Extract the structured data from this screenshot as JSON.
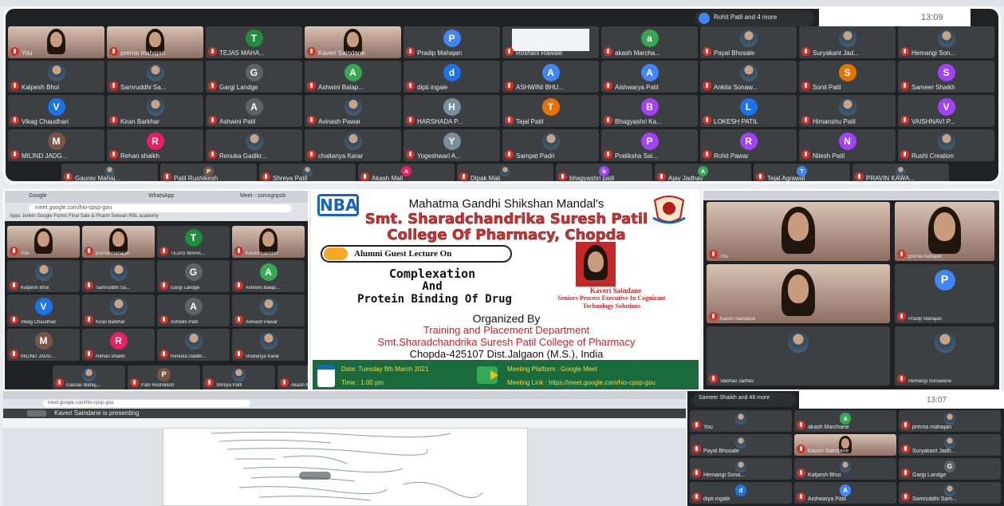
{
  "top_grid": {
    "presenter_chip": "Rohit Patil and 4 more",
    "clock": "13:09",
    "participants": [
      {
        "name": "You",
        "type": "cam"
      },
      {
        "name": "prerna mahajan",
        "type": "cam"
      },
      {
        "name": "TEJAS MAHA...",
        "initial": "T",
        "color": "#1e8e3e"
      },
      {
        "name": "Kaveri Saindane",
        "type": "cam"
      },
      {
        "name": "Pradip Mahajan",
        "initial": "P",
        "color": "#4285f4"
      },
      {
        "name": "Roshani Rawale",
        "type": "screen"
      },
      {
        "name": "akash Marcha...",
        "initial": "a",
        "color": "#34a853"
      },
      {
        "name": "Payal Bhosale",
        "type": "photo"
      },
      {
        "name": "Suryakant Jad...",
        "type": "photo"
      },
      {
        "name": "Hemangi Son...",
        "type": "photo"
      },
      {
        "name": "Kalpesh Bhoi",
        "type": "photo"
      },
      {
        "name": "Samruddhi Sa...",
        "type": "photo"
      },
      {
        "name": "Gargi Landge",
        "initial": "G",
        "color": "#5f6368"
      },
      {
        "name": "Ashwini Balap...",
        "initial": "A",
        "color": "#34a853"
      },
      {
        "name": "dipti ingale",
        "initial": "d",
        "color": "#1a73e8"
      },
      {
        "name": "ASHWINI BHU...",
        "initial": "A",
        "color": "#4285f4"
      },
      {
        "name": "Aishwarya Patil",
        "initial": "A",
        "color": "#4285f4"
      },
      {
        "name": "Ankita Sonaw...",
        "type": "photo"
      },
      {
        "name": "Sonil Patil",
        "initial": "S",
        "color": "#e37400"
      },
      {
        "name": "Sameer Shaikh",
        "initial": "S",
        "color": "#a142f4"
      },
      {
        "name": "Vikag Chaudhari",
        "initial": "V",
        "color": "#1a73e8"
      },
      {
        "name": "Kiran Barkhar",
        "type": "photo"
      },
      {
        "name": "Ashwini Patil",
        "initial": "A",
        "color": "#5f6368"
      },
      {
        "name": "Avinash Pawar",
        "type": "photo"
      },
      {
        "name": "HARSHADA P...",
        "initial": "H",
        "color": "#78909c"
      },
      {
        "name": "Tejal Patil",
        "initial": "T",
        "color": "#e8710a"
      },
      {
        "name": "Bhagyashri Ka...",
        "initial": "B",
        "color": "#a142f4"
      },
      {
        "name": "LOKESH PATIL",
        "initial": "L",
        "color": "#1a73e8"
      },
      {
        "name": "Himanshu Patil",
        "type": "photo"
      },
      {
        "name": "VAISHNAVI P...",
        "initial": "V",
        "color": "#a142f4"
      },
      {
        "name": "MILIND JADG...",
        "initial": "M",
        "color": "#795548"
      },
      {
        "name": "Rehan shaikh",
        "initial": "R",
        "color": "#e91e63"
      },
      {
        "name": "Renuka Gadikr...",
        "type": "photo"
      },
      {
        "name": "chaitanya Karar",
        "type": "photo"
      },
      {
        "name": "Yogeshwari A...",
        "initial": "Y",
        "color": "#78909c"
      },
      {
        "name": "Sampat Padri",
        "type": "photo"
      },
      {
        "name": "Pratiksha Sai...",
        "initial": "P",
        "color": "#a142f4"
      },
      {
        "name": "Rohit Pawar",
        "initial": "R",
        "color": "#a142f4"
      },
      {
        "name": "Nilesh Patil",
        "initial": "N",
        "color": "#a142f4"
      },
      {
        "name": "Rushi Creation",
        "type": "photo"
      }
    ],
    "bottom_row": [
      {
        "name": "Gaurav Mahaj...",
        "type": "photo"
      },
      {
        "name": "Patil Rushikesh",
        "initial": "P",
        "color": "#795548"
      },
      {
        "name": "Shreya Patil",
        "type": "photo"
      },
      {
        "name": "Akash Mali",
        "initial": "A",
        "color": "#e91e63"
      },
      {
        "name": "Dipak Mali",
        "type": "photo"
      },
      {
        "name": "bhagyashri patil",
        "initial": "b",
        "color": "#a142f4"
      },
      {
        "name": "Ajay Jadhav",
        "initial": "A",
        "color": "#34a853"
      },
      {
        "name": "Tejal Agrawal",
        "initial": "T",
        "color": "#4285f4"
      },
      {
        "name": "PRAVIN KAWA...",
        "type": "photo"
      }
    ]
  },
  "mid_left": {
    "tab1": "Google",
    "tab2": "WhatsApp",
    "tab3": "Meet - ssmxgnpsb",
    "url": "meet.google.com/hio-cpsp-gou",
    "bookmarks": "Apps   Jenkin   Google Forms   Final Sale & Pharm   Setwart   RBL academy",
    "participants": [
      {
        "name": "You",
        "type": "cam"
      },
      {
        "name": "prerna mahajan",
        "type": "cam"
      },
      {
        "name": "TEJAS MAHA...",
        "initial": "T",
        "color": "#1e8e3e"
      },
      {
        "name": "Kaveri Saindan",
        "type": "cam"
      },
      {
        "name": "Kalpesh Bhoi",
        "type": "photo"
      },
      {
        "name": "Samruddhi Sa...",
        "type": "photo"
      },
      {
        "name": "Gargi Landge",
        "initial": "G",
        "color": "#5f6368"
      },
      {
        "name": "Ashwini Balap...",
        "initial": "A",
        "color": "#34a853"
      },
      {
        "name": "Vikag Chaudhari",
        "initial": "V",
        "color": "#1a73e8"
      },
      {
        "name": "Kiran Barkhar",
        "type": "photo"
      },
      {
        "name": "Ashwini Patil",
        "initial": "A",
        "color": "#5f6368"
      },
      {
        "name": "Avinash Pawar",
        "type": "photo"
      },
      {
        "name": "MILIND JADG...",
        "initial": "M",
        "color": "#795548"
      },
      {
        "name": "Rehan shaikh",
        "initial": "R",
        "color": "#e91e63"
      },
      {
        "name": "Renuka Gadikr...",
        "type": "photo"
      },
      {
        "name": "chaitanya Karar",
        "type": "photo"
      }
    ],
    "bottom": [
      {
        "name": "Gaurav Mahaj...",
        "type": "photo"
      },
      {
        "name": "Patil Rushikesh",
        "initial": "P",
        "color": "#795548"
      },
      {
        "name": "Shreya Patil",
        "type": "photo"
      },
      {
        "name": "Akash M",
        "initial": "A",
        "color": "#e91e63"
      }
    ]
  },
  "poster": {
    "logo": "NBA",
    "society": "Mahatma Gandhi Shikshan Mandal's",
    "college_line1": "Smt. Sharadchandrika Suresh Patil",
    "college_line2": "College Of Pharmacy, Chopda",
    "event_type": "Alumni Guest Lecture On",
    "topic1": "Complexation",
    "topic2": "And",
    "topic3": "Protein Binding Of Drug",
    "speaker_name": "Kaveri Saindane",
    "speaker_role1": "Seniors Process Executive In Cognizant",
    "speaker_role2": "Technology Solutions",
    "organized": "Organized By",
    "dept": "Training and Placement Department",
    "org_college": "Smt.Sharadchandrika Suresh Patil College of Pharmacy",
    "address": "Chopda-425107 Dist.Jalgaon (M.S.), India",
    "date": "Date: Tuesday 9th March 2021",
    "time": "Time : 1.00 pm",
    "platform": "Meeting Platform : Google Meet",
    "link": "Meeting Link : https://meet.google.com/hio-cpsp-gou"
  },
  "mid_right": {
    "participants": [
      {
        "name": "You",
        "type": "cam"
      },
      {
        "name": "prerna mahajan",
        "type": "cam"
      },
      {
        "name": "Kaveri Saindane",
        "type": "cam"
      },
      {
        "name": "Pradip Mahajan",
        "initial": "P",
        "color": "#4285f4"
      },
      {
        "name": "Vaibhav Jadhav",
        "type": "photo"
      },
      {
        "name": "Hemangi Sonawane",
        "type": "photo"
      }
    ]
  },
  "bottom_left": {
    "url": "meet.google.com/hio-cpsp-gou",
    "presenting": "Kaveri Saindane is presenting"
  },
  "bottom_right": {
    "chip": "Sameer Shaikh and 46 more",
    "clock": "13:07",
    "participants": [
      {
        "name": "You",
        "type": "photo"
      },
      {
        "name": "akash Marchane",
        "initial": "a",
        "color": "#34a853"
      },
      {
        "name": "prerna mahajan",
        "type": "photo"
      },
      {
        "name": "Payal Bhosale",
        "type": "photo"
      },
      {
        "name": "Kaveri Saindane",
        "type": "cam"
      },
      {
        "name": "Suryakant Jadh...",
        "type": "photo"
      },
      {
        "name": "Hemangi Sona...",
        "type": "photo"
      },
      {
        "name": "Kalpesh Bhoi",
        "type": "photo"
      },
      {
        "name": "Gargi Landge",
        "initial": "G",
        "color": "#5f6368"
      },
      {
        "name": "dipti ingale",
        "initial": "d",
        "color": "#1a73e8"
      },
      {
        "name": "Aishwarya Patil",
        "initial": "A",
        "color": "#4285f4"
      },
      {
        "name": "Samruddhi Sam...",
        "type": "photo"
      }
    ]
  }
}
